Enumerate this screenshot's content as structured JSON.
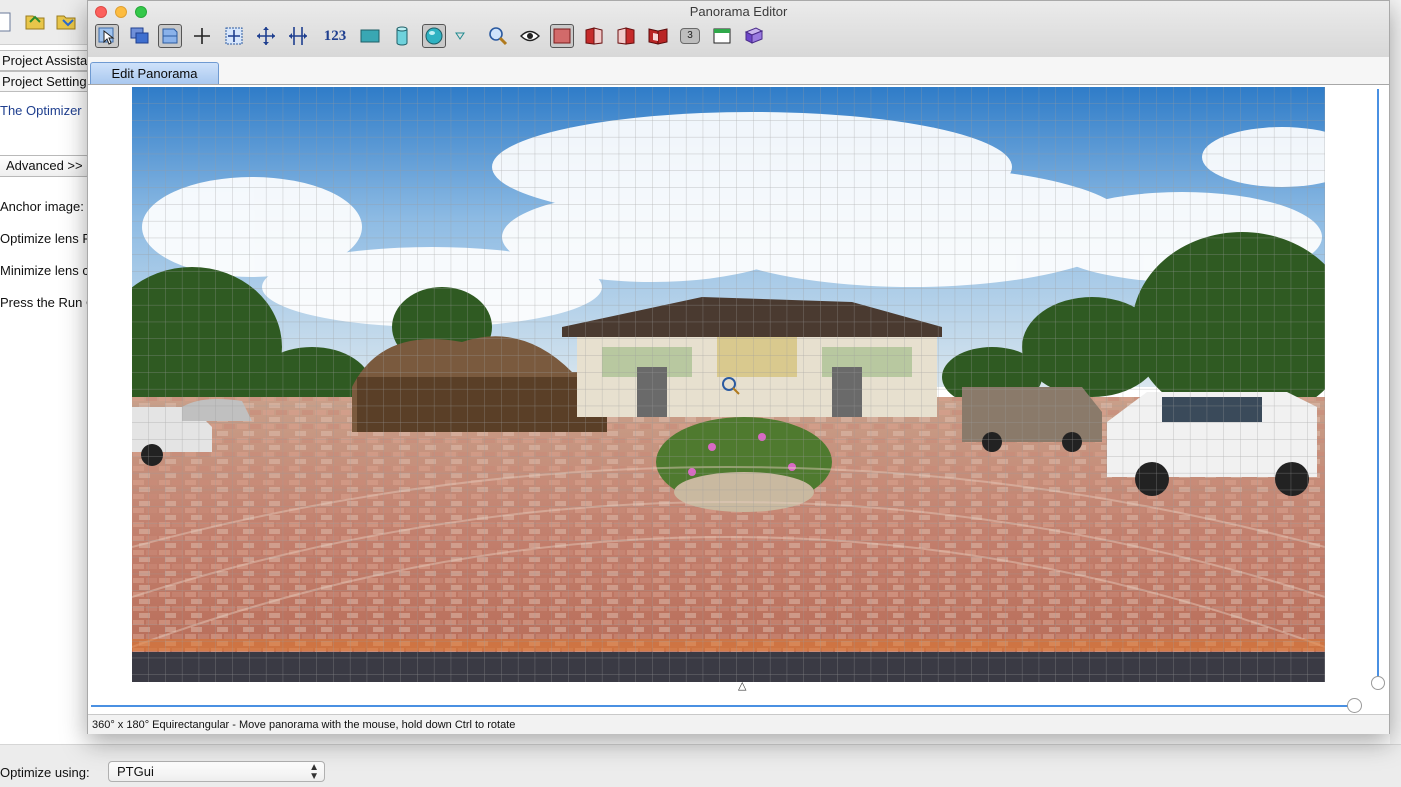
{
  "background_window": {
    "tabs": [
      "Project Assista",
      "Project Setting"
    ],
    "optimizer_text": "The Optimizer",
    "advanced_button": "Advanced >>",
    "anchor_label": "Anchor image:",
    "optimize_lens_label": "Optimize lens F",
    "minimize_lens_label": "Minimize lens c",
    "press_run_text": "Press the Run C",
    "optimize_using_label": "Optimize using:",
    "optimize_using_value": "PTGui"
  },
  "window": {
    "title": "Panorama Editor"
  },
  "toolbar": {
    "numbers_label": "123",
    "count_badge": "3",
    "icons": [
      "select-arrow-icon",
      "multi-image-icon",
      "image-layout-icon",
      "crosshair-icon",
      "center-point-icon",
      "move-arrows-icon",
      "horizon-arrows-icon",
      "numbers-icon",
      "rectangle-projection-icon",
      "cylinder-projection-icon",
      "sphere-projection-icon",
      "dropdown-triangle-icon",
      "zoom-magnifier-icon",
      "eye-icon",
      "rect-selection-icon",
      "left-panel-icon",
      "right-panel-icon",
      "book-panel-icon",
      "badge-count-icon",
      "window-icon",
      "book-icon"
    ]
  },
  "tabs": {
    "active": "Edit Panorama"
  },
  "status": {
    "text": "360° x 180° Equirectangular - Move panorama with the mouse, hold down Ctrl to rotate"
  },
  "colors": {
    "accent": "#4a90e2",
    "tab_active_top": "#cfe2fa",
    "tab_active_bottom": "#a9c8ef"
  }
}
